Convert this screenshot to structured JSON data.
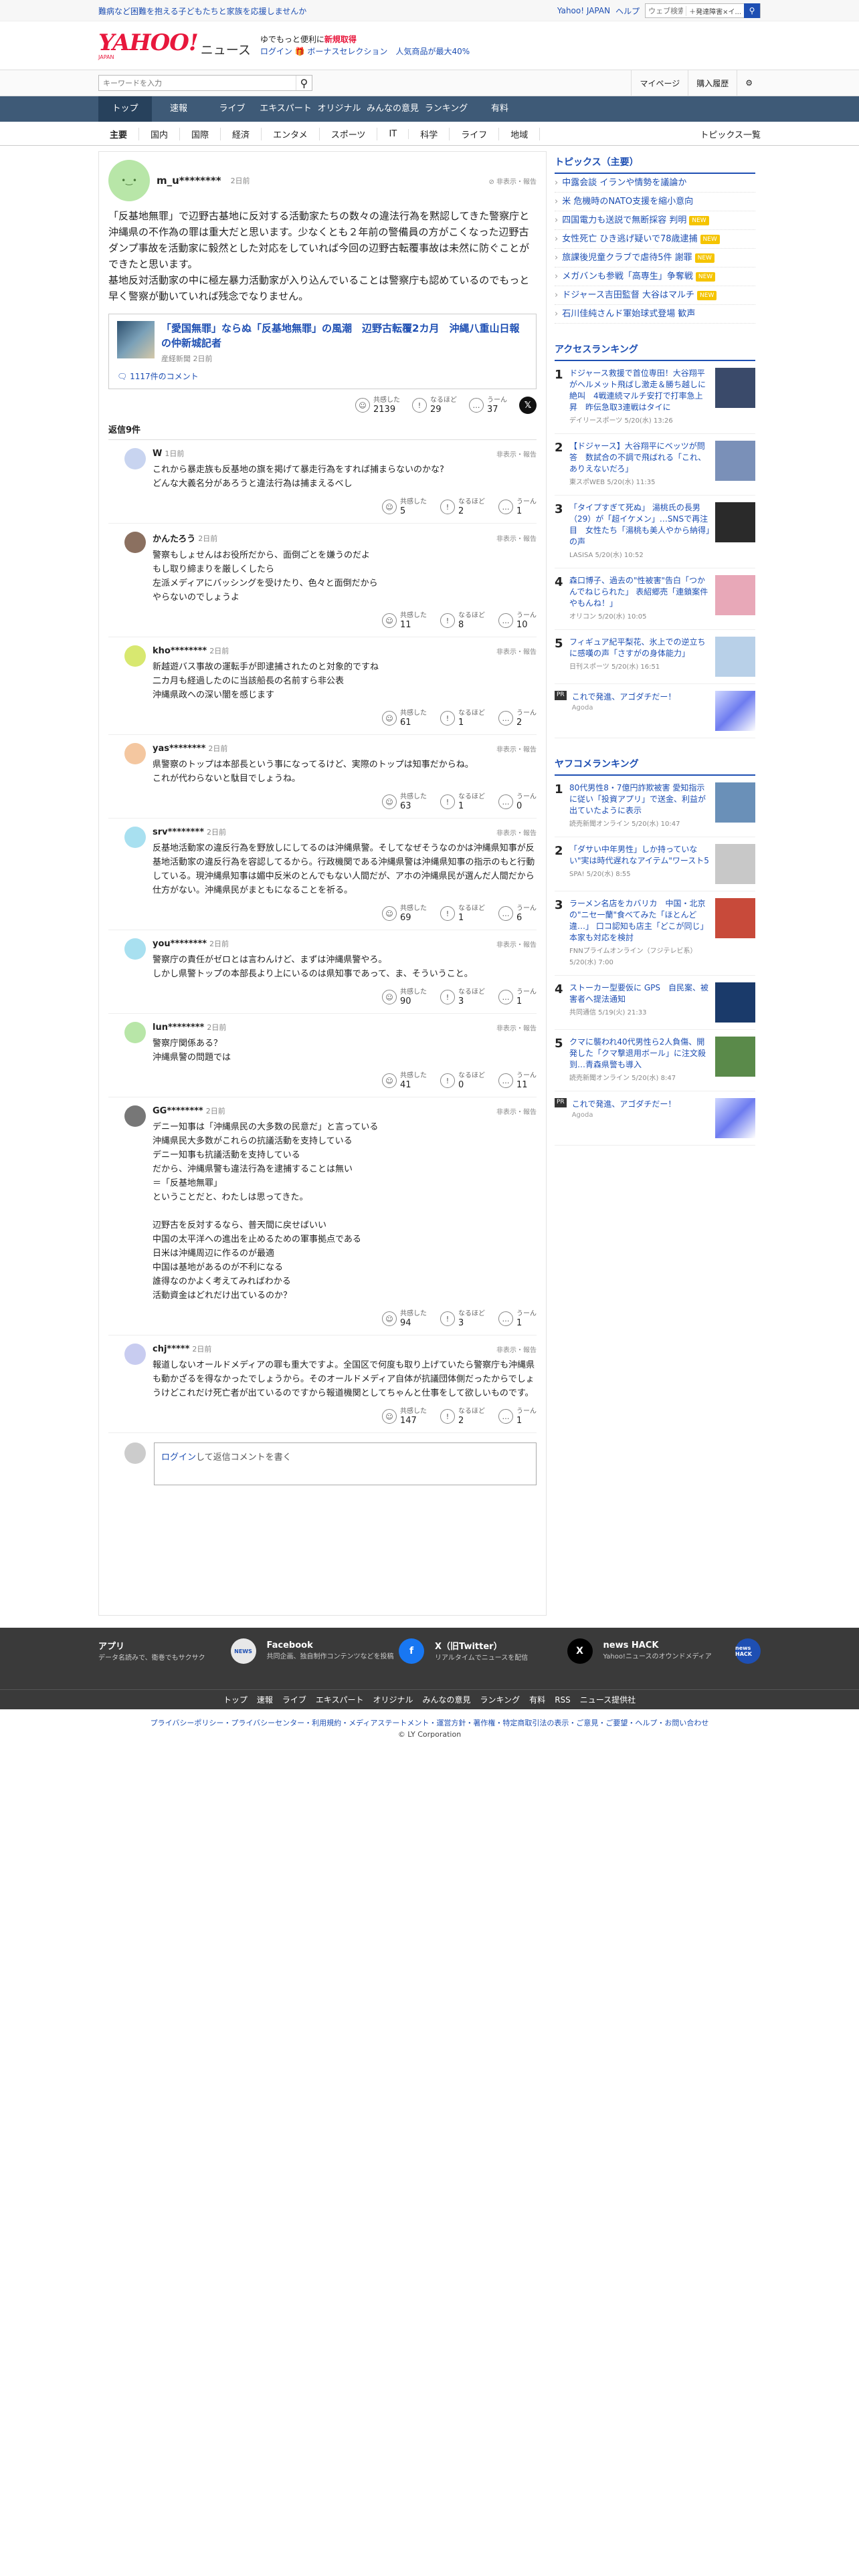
{
  "top": {
    "promo": "難病など困難を抱える子どもたちと家族を応援しませんか",
    "links": [
      "Yahoo! JAPAN",
      "ヘルプ"
    ],
    "search_placeholder": "ウェブ検索",
    "search_scope": "＋発達障害×イ..."
  },
  "brand": {
    "logo": "YAHOO!",
    "logo_sub": "JAPAN",
    "service": "ニュース",
    "tag1": "ゆでもっと便利に",
    "tag1b": "新規取得",
    "login": "ログイン",
    "bonus": "ボーナスセレクション",
    "bonus2": "人気商品が最大40%"
  },
  "bar": {
    "kw_placeholder": "キーワードを入力",
    "links": [
      "マイページ",
      "購入履歴"
    ]
  },
  "gnav": [
    "トップ",
    "速報",
    "ライブ",
    "エキスパート",
    "オリジナル",
    "みんなの意見",
    "ランキング",
    "有料"
  ],
  "cnav": {
    "items": [
      "主要",
      "国内",
      "国際",
      "経済",
      "エンタメ",
      "スポーツ",
      "IT",
      "科学",
      "ライフ",
      "地域"
    ],
    "all": "トピックス一覧"
  },
  "comment": {
    "user": "m_u********",
    "time": "2日前",
    "flag": "非表示・報告",
    "text": "「反基地無罪」で辺野古基地に反対する活動家たちの数々の違法行為を黙認してきた警察庁と沖縄県の不作為の罪は重大だと思います。少なくとも２年前の警備員の方がこくなった辺野古ダンプ事故を活動家に毅然とした対応をしていれば今回の辺野古転覆事故は未然に防ぐことができたと思います。\n基地反対活動家の中に極左暴力活動家が入り込んでいることは警察庁も認めているのでもっと早く警察が動いていれば残念でなりません。",
    "article": {
      "title": "「愛国無罪」ならぬ「反基地無罪」の風潮　辺野古転覆2カ月　沖縄八重山日報の仲新城記者",
      "source": "産経新聞 2日前",
      "comments": "1117件のコメント"
    },
    "r": {
      "k": "共感した",
      "kv": "2139",
      "n": "なるほど",
      "nv": "29",
      "u": "うーん",
      "uv": "37"
    }
  },
  "reply_header": "返信9件",
  "replies": [
    {
      "user": "W",
      "time": "1日前",
      "text": "これから暴走族も反基地の旗を掲げて暴走行為をすれば捕まらないのかな?\nどんな大義名分があろうと違法行為は捕まえるべし",
      "k": "5",
      "n": "2",
      "u": "1",
      "c": "#c8d4f0"
    },
    {
      "user": "かんたろう",
      "time": "2日前",
      "text": "警察もしょせんはお役所だから、面倒ごとを嫌うのだよ\nもし取り締まりを厳しくしたら\n左派メディアにバッシングを受けたり、色々と面倒だから\nやらないのでしょうよ",
      "k": "11",
      "n": "8",
      "u": "10",
      "c": "#8b7060"
    },
    {
      "user": "kho********",
      "time": "2日前",
      "text": "新越遊バス事故の運転手が即逮捕されたのと対象的ですね\n二カ月も経過したのに当該船長の名前すら非公表\n沖縄県政への深い闇を感じます",
      "k": "61",
      "n": "1",
      "u": "2",
      "c": "#d8e870"
    },
    {
      "user": "yas********",
      "time": "2日前",
      "text": "県警察のトップは本部長という事になってるけど、実際のトップは知事だからね。\nこれが代わらないと駄目でしょうね。",
      "k": "63",
      "n": "1",
      "u": "0",
      "c": "#f4c7a0"
    },
    {
      "user": "srv********",
      "time": "2日前",
      "text": "反基地活動家の違反行為を野放しにしてるのは沖縄県警。そしてなぜそうなのかは沖縄県知事が反基地活動家の違反行為を容認してるから。行政機関である沖縄県警は沖縄県知事の指示のもと行動している。現沖縄県知事は媚中反米のとんでもない人間だが、アホの沖縄県民が選んだ人間だから仕方がない。沖縄県民がまともになることを祈る。",
      "k": "69",
      "n": "1",
      "u": "6",
      "c": "#a8e0f0"
    },
    {
      "user": "you********",
      "time": "2日前",
      "text": "警察庁の責任がゼロとは言わんけど、まずは沖縄県警やろ。\nしかし県警トップの本部長より上にいるのは県知事であって、ま、そういうこと。",
      "k": "90",
      "n": "3",
      "u": "1",
      "c": "#a8e0f0"
    },
    {
      "user": "lun********",
      "time": "2日前",
      "text": "警察庁関係ある？\n沖縄県警の問題では",
      "k": "41",
      "n": "0",
      "u": "11",
      "c": "#b8e6a8"
    },
    {
      "user": "GG********",
      "time": "2日前",
      "text": "デニー知事は「沖縄県民の大多数の民意だ」と言っている\n沖縄県民大多数がこれらの抗議活動を支持している\nデニー知事も抗議活動を支持している\nだから、沖縄県警も違法行為を逮捕することは無い\n＝「反基地無罪」\nということだと、わたしは思ってきた。\n\n辺野古を反対するなら、普天間に戻せばいい\n中国の太平洋への進出を止めるための軍事拠点である\n日米は沖縄周辺に作るのが最適\n中国は基地があるのが不利になる\n誰得なのかよく考えてみればわかる\n活動資金はどれだけ出ているのか？",
      "k": "94",
      "n": "3",
      "u": "1",
      "c": "#777777"
    },
    {
      "user": "chj*****",
      "time": "2日前",
      "text": "報道しないオールドメディアの罪も重大ですよ。全国区で何度も取り上げていたら警察庁も沖縄県も動かざるを得なかったでしょうから。そのオールドメディア自体が抗議団体側だったからでしょうけどこれだけ死亡者が出ているのですから報道機関としてちゃんと仕事をして欲しいものです。",
      "k": "147",
      "n": "2",
      "u": "1",
      "c": "#c8ccf0"
    }
  ],
  "reply_labels": {
    "k": "共感した",
    "n": "なるほど",
    "u": "うーん",
    "flag": "非表示・報告"
  },
  "reply_input": {
    "login": "ログイン",
    "rest": "して返信コメントを書く"
  },
  "side": {
    "topics_title": "トピックス（主要）",
    "topics": [
      {
        "t": "中露会談 イランや情勢を議論か",
        "new": false
      },
      {
        "t": "米 危機時のNATO支援を縮小意向",
        "new": false
      },
      {
        "t": "四国電力も送説で無断採容 判明",
        "new": true
      },
      {
        "t": "女性死亡 ひき逃げ疑いで78歳逮捕",
        "new": true
      },
      {
        "t": "旅課後児童クラブで虐待5件 謝罪",
        "new": true
      },
      {
        "t": "メガバンも参戦「高専生」争奪戦",
        "new": true
      },
      {
        "t": "ドジャース吉田監督 大谷はマルチ",
        "new": true
      },
      {
        "t": "石川佳純さんド軍始球式登場 歓声",
        "new": false
      }
    ],
    "access_title": "アクセスランキング",
    "access": [
      {
        "t": "ドジャース救援で首位専田！大谷翔平がヘルメット飛ばし激走＆勝ち越しに絶叫　4戦連続マルチ安打で打率急上昇　昨伝急取3連戦はタイに",
        "s": "デイリースポーツ 5/20(水) 13:26",
        "c": "#3a4a6a"
      },
      {
        "t": "【ドジャース】大谷翔平にベッツが問答　数試合の不調で飛ばれる「これ、ありえないだろ」",
        "s": "東スポWEB 5/20(水) 11:35",
        "c": "#7a90b8"
      },
      {
        "t": "「タイプすぎて死ぬ」 湯桃氏の長男（29）が「超イケメン」…SNSで再注目　女性たち「湯桃も美人やから納得」の声",
        "s": "LASISA 5/20(水) 10:52",
        "c": "#2a2a2a"
      },
      {
        "t": "森口博子、過去の\"性被害\"告白「つかんでねじられた」 表紹郷売「連鎖案件やもんね！」",
        "s": "オリコン 5/20(水) 10:05",
        "c": "#e8a8b8"
      },
      {
        "t": "フィギュア紀平梨花、氷上での逆立ちに感嘆の声「さすがの身体能力」",
        "s": "日刊スポーツ 5/20(水) 16:51",
        "c": "#b8d0e8"
      }
    ],
    "pr": {
      "t": "これで発進、アゴダチだー！",
      "s": "Agoda",
      "ad": "広告"
    },
    "yafoo_title": "ヤフコメランキング",
    "yafoo": [
      {
        "t": "80代男性8・7億円詐欺被害 愛知指示に従い「投資アプリ」で送金、利益が出ていたように表示",
        "s": "読売新聞オンライン 5/20(水) 10:47",
        "c": "#6a90b8"
      },
      {
        "t": "「ダサい中年男性」しか持っていない\"実は時代遅れなアイテム\"ワースト5",
        "s": "SPA! 5/20(水) 8:55",
        "c": "#c8c8c8"
      },
      {
        "t": "ラーメン名店をカバリカ　中国・北京の\"ニセ一蘭\"食べてみた「ほとんど違…」 口コ認知も店主「どこが同じ」　本家も対応を検討",
        "s": "FNNプライムオンライン（フジテレビ系） 5/20(水) 7:00",
        "c": "#c84a3a"
      },
      {
        "t": "ストーカー型要仮に GPS　自民案、被害者へ提法通知",
        "s": "共同通信 5/19(火) 21:33",
        "c": "#1a3a6a"
      },
      {
        "t": "クマに襲われ40代男性ら2人負傷、開発した「クマ撃退用ボール」に注文殺到…青森県警も導入",
        "s": "読売新聞オンライン 5/20(水) 8:47",
        "c": "#5a8a4a"
      }
    ]
  },
  "footer": {
    "blocks": [
      {
        "h": "アプリ",
        "d": "データ名読みで、衛巻でもサクサク",
        "i": "NEWS",
        "c": "#e8e8e8"
      },
      {
        "h": "Facebook",
        "d": "共同企画、独自制作コンテンツなどを投稿",
        "i": "f",
        "c": "#1877f2"
      },
      {
        "h": "X（旧Twitter）",
        "d": "リアルタイムでニュースを配信",
        "i": "X",
        "c": "#000000"
      },
      {
        "h": "news HACK",
        "d": "Yahoo!ニュースのオウンドメディア",
        "i": "news HACK",
        "c": "#1e4fb3"
      }
    ],
    "nav": [
      "トップ",
      "速報",
      "ライブ",
      "エキスパート",
      "オリジナル",
      "みんなの意見",
      "ランキング",
      "有料",
      "RSS",
      "ニュース提供社"
    ],
    "legal": "プライバシーポリシー・プライバシーセンター・利用規約・メディアステートメント・運営方針・著作権・特定商取引法の表示・ご意見・ご要望・ヘルプ・お問い合わせ",
    "copy": "© LY Corporation"
  }
}
